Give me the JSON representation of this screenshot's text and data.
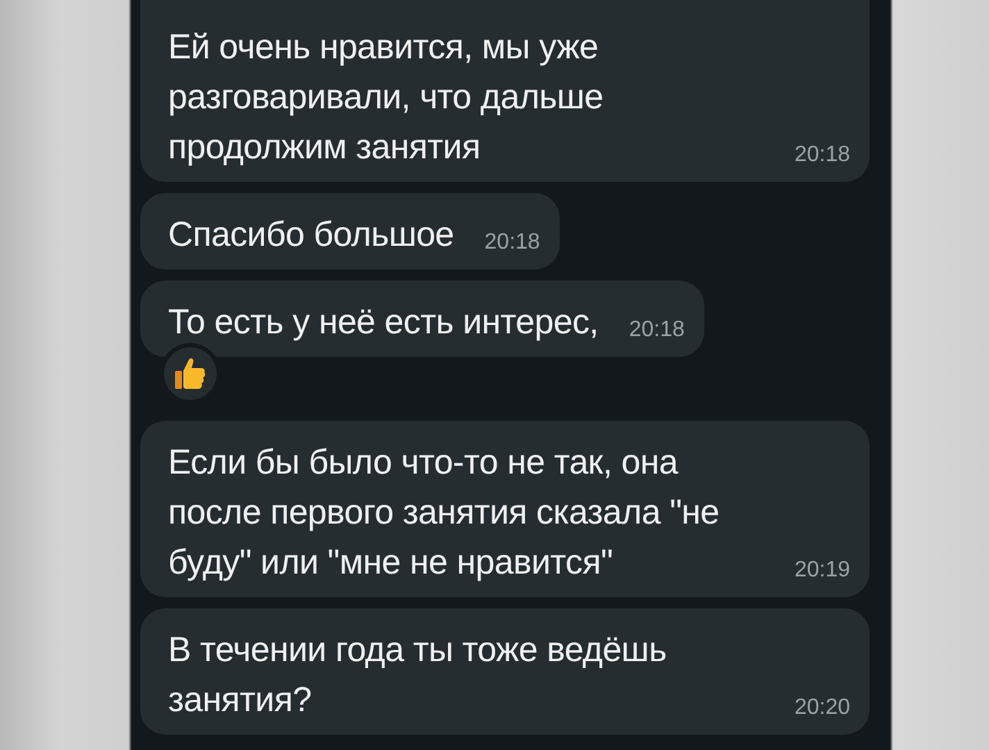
{
  "messages": [
    {
      "text": "Ей очень нравится, мы уже разговаривали, что дальше продолжим занятия",
      "time": "20:18",
      "has_reaction": false
    },
    {
      "text": "Спасибо большое",
      "time": "20:18",
      "has_reaction": false
    },
    {
      "text": "То есть у неё есть интерес,",
      "time": "20:18",
      "has_reaction": true
    },
    {
      "text": "Если бы было что-то не так, она после первого занятия сказала \"не буду\" или \"мне не нравится\"",
      "time": "20:19",
      "has_reaction": false
    },
    {
      "text": "В течении года ты тоже ведёшь занятия?",
      "time": "20:20",
      "has_reaction": false
    }
  ]
}
